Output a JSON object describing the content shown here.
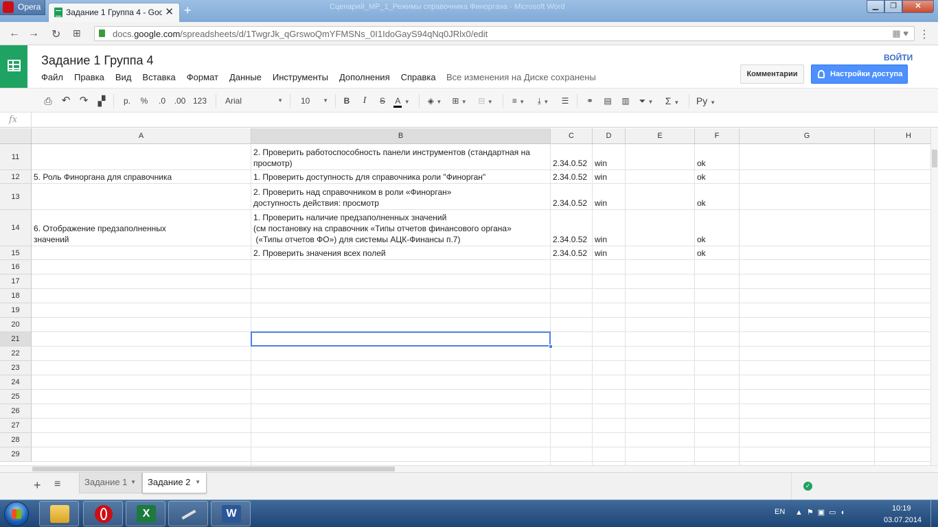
{
  "browser": {
    "menu_label": "Opera",
    "tab_title": "Задание 1 Группа 4 - Goo",
    "new_tab_icon": "+",
    "bg_window_title": "Сценарий_MP_1_Режимы справочника Финоргана - Microsoft Word",
    "url_prefix": "docs.",
    "url_domain": "google.com",
    "url_path": "/spreadsheets/d/1TwgrJk_qGrswoQmYFMSNs_0I1IdoGayS94qNq0JRlx0/edit"
  },
  "doc": {
    "title": "Задание 1 Группа 4",
    "menu": [
      "Файл",
      "Правка",
      "Вид",
      "Вставка",
      "Формат",
      "Данные",
      "Инструменты",
      "Дополнения",
      "Справка"
    ],
    "save_status": "Все изменения на Диске сохранены",
    "login": "ВОЙТИ",
    "comments_button": "Комментарии",
    "share_button": "Настройки доступа"
  },
  "toolbar": {
    "currency": "р.",
    "percent": "%",
    "dec_decrease": ".0",
    "dec_increase": ".00",
    "more_formats": "123",
    "font": "Arial",
    "font_size": "10",
    "bold": "B",
    "italic": "I",
    "strike": "S",
    "text_color": "A",
    "sum": "Σ",
    "input_tools": "Ру"
  },
  "formula_bar": {
    "label": "fx",
    "value": ""
  },
  "grid": {
    "columns": [
      "A",
      "B",
      "C",
      "D",
      "E",
      "F",
      "G",
      "H"
    ],
    "selected_column": "B",
    "selected_row": "21",
    "rows": [
      {
        "num": "11",
        "A": "",
        "B": "2. Проверить работоспособность панели инструментов (стандартная на\nпросмотр)",
        "C": "2.34.0.52",
        "D": "win",
        "E": "",
        "F": "ok"
      },
      {
        "num": "12",
        "A": "5. Роль Финоргана для справочника",
        "B": "1. Проверить доступность для справочника роли \"Финорган\"",
        "C": "2.34.0.52",
        "D": "win",
        "E": "",
        "F": "ok"
      },
      {
        "num": "13",
        "A": "",
        "B": "2. Проверить над справочником в роли «Финорган»\nдоступность действия: просмотр",
        "C": "2.34.0.52",
        "D": "win",
        "E": "",
        "F": "ok"
      },
      {
        "num": "14",
        "A": "6. Отображение предзаполненных\nзначений",
        "B": "1. Проверить наличие предзаполненных значений\n(см постановку на справочник «Типы отчетов финансового органа»\n («Типы отчетов ФО») для системы АЦК-Финансы п.7)",
        "C": "2.34.0.52",
        "D": "win",
        "E": "",
        "F": "ok"
      },
      {
        "num": "15",
        "A": "",
        "B": "2. Проверить значения всех полей",
        "C": "2.34.0.52",
        "D": "win",
        "E": "",
        "F": "ok"
      },
      {
        "num": "16"
      },
      {
        "num": "17"
      },
      {
        "num": "18"
      },
      {
        "num": "19"
      },
      {
        "num": "20"
      },
      {
        "num": "21"
      },
      {
        "num": "22"
      },
      {
        "num": "23"
      },
      {
        "num": "24"
      },
      {
        "num": "25"
      },
      {
        "num": "26"
      },
      {
        "num": "27"
      },
      {
        "num": "28"
      },
      {
        "num": "29"
      }
    ]
  },
  "sheets": {
    "tabs": [
      "Задание 1",
      "Задание 2"
    ],
    "active": "Задание 2"
  },
  "taskbar": {
    "apps": [
      "explorer",
      "opera",
      "excel",
      "network-tool",
      "word"
    ],
    "excel_letter": "X",
    "word_letter": "W",
    "language": "EN",
    "time": "10:19",
    "date": "03.07.2014"
  },
  "colors": {
    "sheets_green": "#1ea362",
    "share_blue": "#4d90fe",
    "selection_blue": "#4d7fe3",
    "taskbar_blue": "#1e4575"
  }
}
